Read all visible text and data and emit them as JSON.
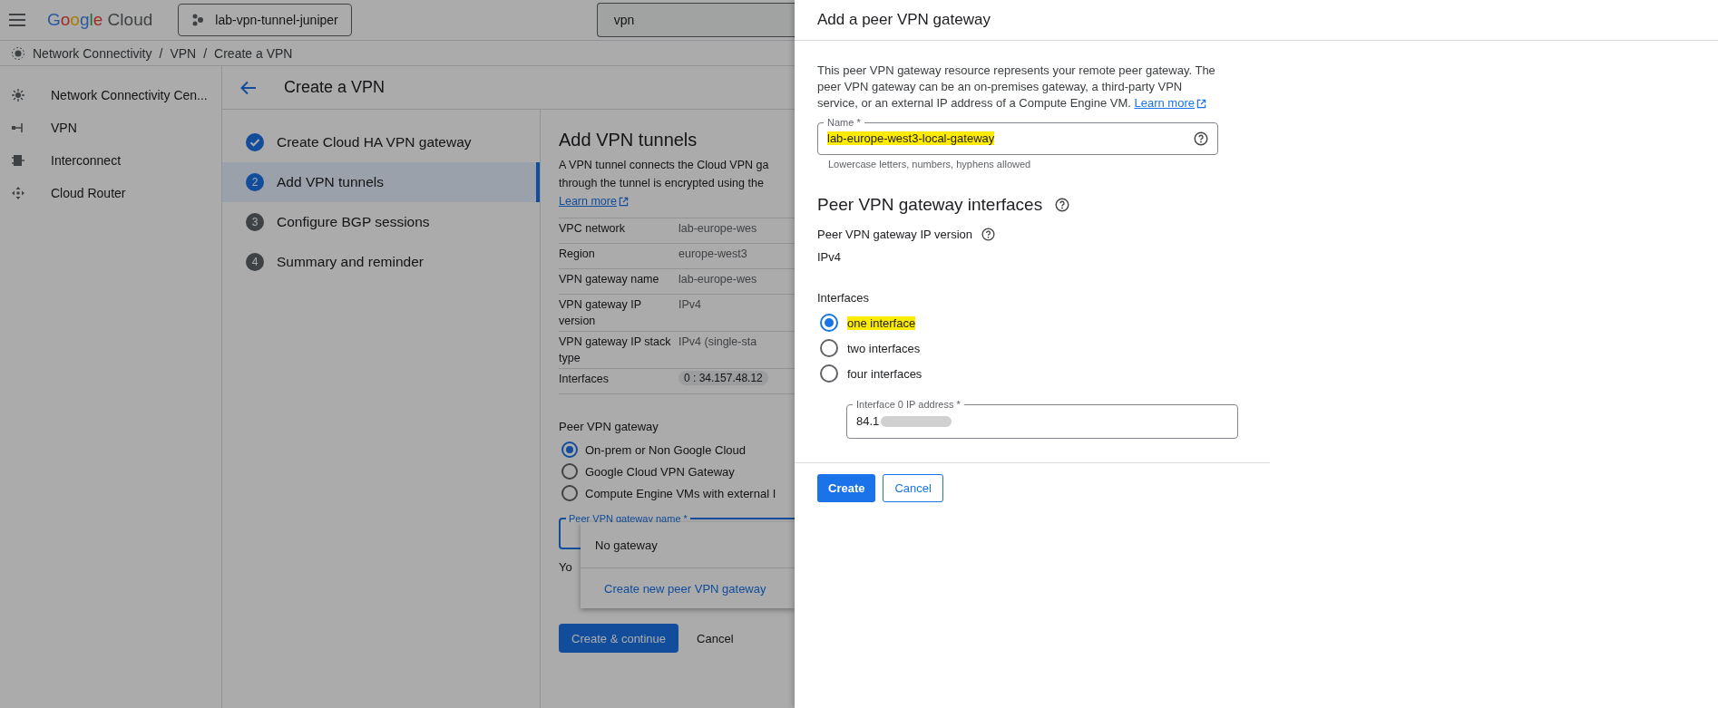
{
  "top_bar": {
    "logo": "Google Cloud",
    "project": "lab-vpn-tunnel-juniper",
    "search": {
      "value": "vpn"
    }
  },
  "breadcrumbs": {
    "separator": "/",
    "items": [
      "Network Connectivity",
      "VPN",
      "Create a VPN"
    ]
  },
  "sidebar": {
    "items": [
      {
        "label": "Network Connectivity Cen...",
        "kind": "hub"
      },
      {
        "label": "VPN",
        "kind": "vpn"
      },
      {
        "label": "Interconnect",
        "kind": "interconnect"
      },
      {
        "label": "Cloud Router",
        "kind": "router"
      }
    ]
  },
  "page": {
    "title": "Create a VPN",
    "steps": [
      {
        "completed": true,
        "selected": false,
        "label": "Create Cloud HA VPN gateway"
      },
      {
        "completed": false,
        "selected": true,
        "number": "2",
        "label": "Add VPN tunnels"
      },
      {
        "completed": false,
        "selected": false,
        "number": "3",
        "label": "Configure BGP sessions"
      },
      {
        "completed": false,
        "selected": false,
        "number": "4",
        "label": "Summary and reminder"
      }
    ]
  },
  "section": {
    "title": "Add VPN tunnels",
    "description_lines": [
      "A VPN tunnel connects the Cloud VPN ga",
      "through the tunnel is encrypted using the"
    ],
    "learn_more": "Learn more",
    "details": [
      {
        "label": "VPC network",
        "value": "lab-europe-wes",
        "kind": "text"
      },
      {
        "label": "Region",
        "value": "europe-west3",
        "kind": "text"
      },
      {
        "label": "VPN gateway name",
        "value": "lab-europe-wes",
        "kind": "text"
      },
      {
        "label": "VPN gateway IP version",
        "value": "IPv4",
        "kind": "text"
      },
      {
        "label": "VPN gateway IP stack type",
        "value": "IPv4 (single-sta",
        "kind": "text"
      },
      {
        "label": "Interfaces",
        "value": "0 : 34.157.48.12",
        "kind": "chip"
      }
    ],
    "peer_gateway": {
      "label": "Peer VPN gateway",
      "options": [
        {
          "label": "On-prem or Non Google Cloud",
          "selected": true
        },
        {
          "label": "Google Cloud VPN Gateway",
          "selected": false
        },
        {
          "label": "Compute Engine VMs with external I",
          "selected": false
        }
      ]
    },
    "peer_name_field": {
      "label": "Peer VPN gateway name *"
    },
    "note": "Yo",
    "dropdown": {
      "items": [
        {
          "label": "No gateway",
          "kind": "option"
        },
        {
          "label": "Create new peer VPN gateway",
          "kind": "action"
        }
      ]
    },
    "buttons": [
      {
        "label": "Create & continue",
        "kind": "primary"
      },
      {
        "label": "Cancel",
        "kind": "text"
      }
    ]
  },
  "panel": {
    "title": "Add a peer VPN gateway",
    "description": "This peer VPN gateway resource represents your remote peer gateway. The peer VPN gateway can be an on-premises gateway, a third-party VPN service, or an external IP address of a Compute Engine VM.",
    "learn_more": "Learn more",
    "name_field": {
      "label": "Name *",
      "value": "lab-europe-west3-local-gateway",
      "highlighted": true,
      "hint": "Lowercase letters, numbers, hyphens allowed"
    },
    "interfaces_heading": "Peer VPN gateway interfaces",
    "ip_version_label": "Peer VPN gateway IP version",
    "ip_version": "IPv4",
    "interfaces_label": "Interfaces",
    "interface_options": [
      {
        "label": "one interface",
        "selected": true,
        "highlighted": true
      },
      {
        "label": "two interfaces",
        "selected": false,
        "highlighted": false
      },
      {
        "label": "four interfaces",
        "selected": false,
        "highlighted": false
      }
    ],
    "ip_field": {
      "label": "Interface 0 IP address *",
      "value": "84.1",
      "redacted": true
    },
    "buttons": [
      {
        "label": "Create",
        "kind": "primary"
      },
      {
        "label": "Cancel",
        "kind": "secondary"
      }
    ]
  }
}
